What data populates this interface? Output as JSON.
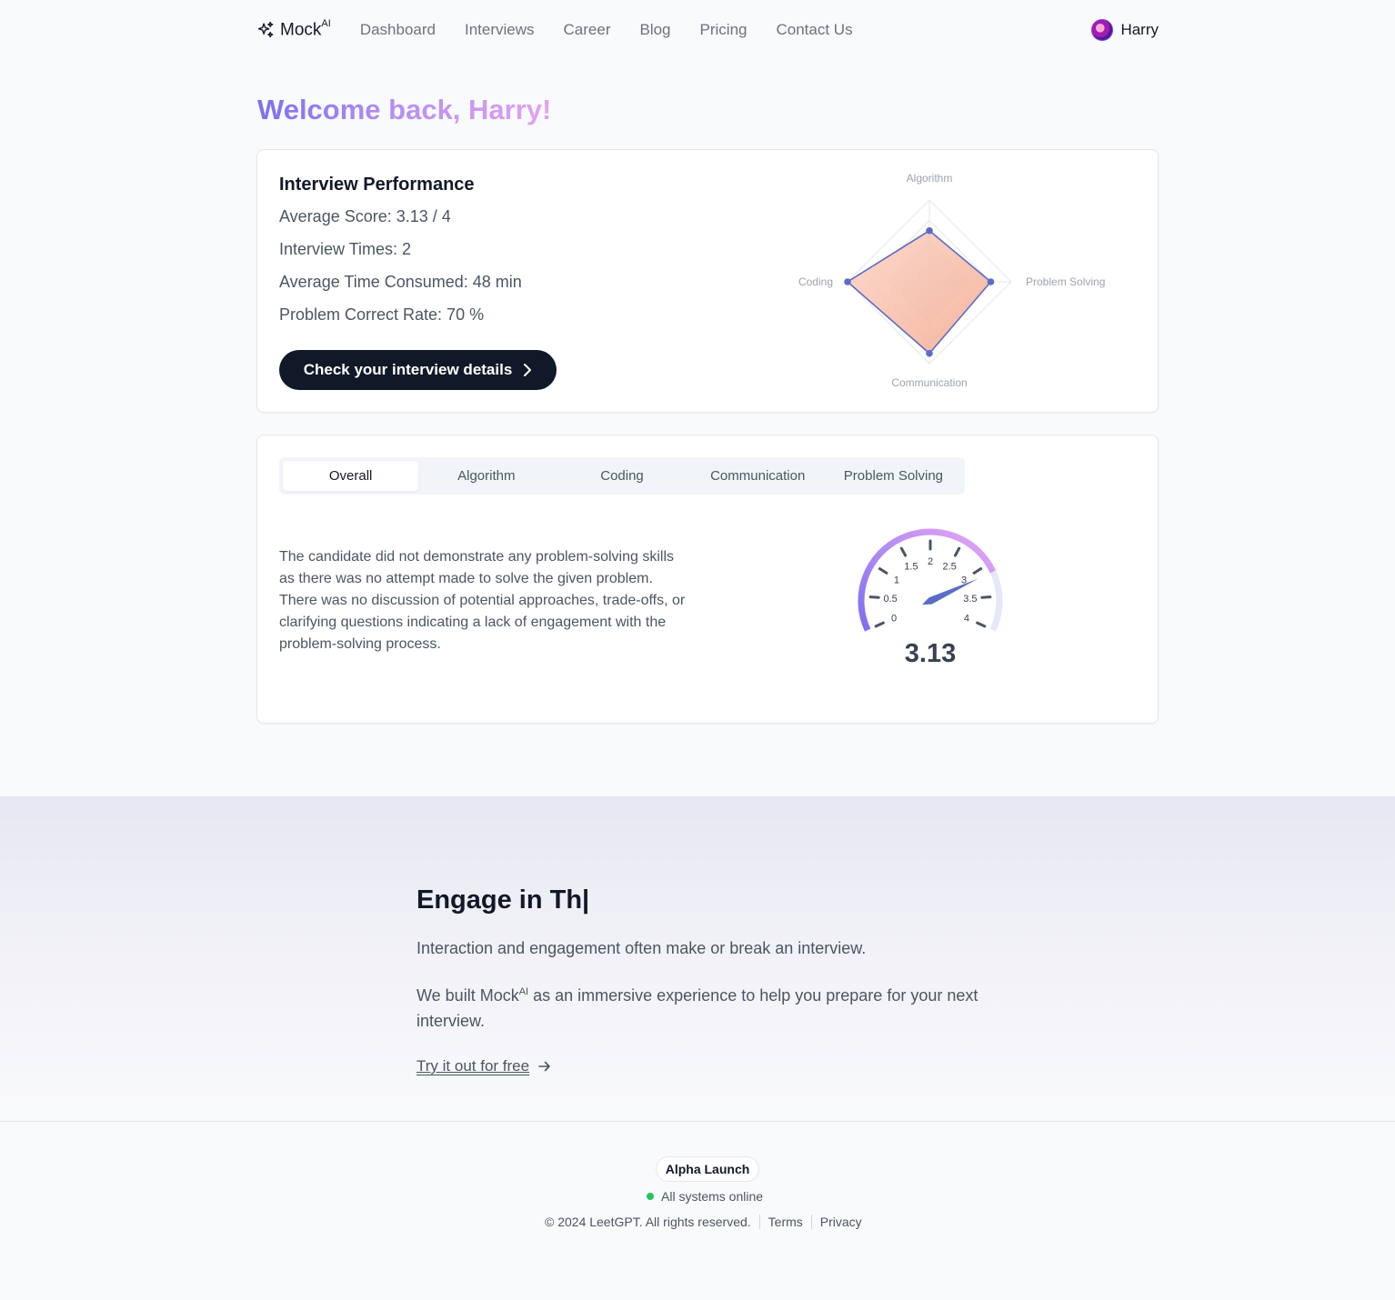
{
  "header": {
    "brand": "Mock",
    "brand_sup": "AI",
    "nav": [
      "Dashboard",
      "Interviews",
      "Career",
      "Blog",
      "Pricing",
      "Contact Us"
    ],
    "user": "Harry"
  },
  "welcome": "Welcome back, Harry!",
  "performance": {
    "title": "Interview Performance",
    "average_score": "Average Score: 3.13 / 4",
    "interview_times": "Interview Times: 2",
    "average_time": "Average Time Consumed: 48 min",
    "correct_rate": "Problem Correct Rate: 70 %",
    "cta_label": "Check your interview details"
  },
  "chart_data": [
    {
      "type": "radar",
      "axes": [
        "Algorithm",
        "Problem Solving",
        "Communication",
        "Coding"
      ],
      "max": 4,
      "values": [
        2.5,
        3.0,
        3.5,
        4.0
      ]
    },
    {
      "type": "gauge",
      "min": 0,
      "max": 4,
      "ticks": [
        "0",
        "0.5",
        "1",
        "1.5",
        "2",
        "2.5",
        "3",
        "3.5",
        "4"
      ],
      "value": 3.13,
      "value_label": "3.13"
    }
  ],
  "tabs": {
    "items": [
      "Overall",
      "Algorithm",
      "Coding",
      "Communication",
      "Problem Solving"
    ],
    "active": "Overall"
  },
  "feedback": "The candidate did not demonstrate any problem-solving skills as there was no attempt made to solve the given problem. There was no discussion of potential approaches, trade-offs, or clarifying questions indicating a lack of engagement with the problem-solving process.",
  "engage": {
    "title": "Engage in  Th|",
    "p1": "Interaction and engagement often make or break an interview.",
    "p2_pre": "We built Mock",
    "p2_sup": "AI",
    "p2_post": " as an immersive experience to help you prepare for your next interview.",
    "link": "Try it out for free"
  },
  "footer": {
    "badge": "Alpha Launch",
    "status": "All systems online",
    "copyright": "© 2024 LeetGPT. All rights reserved.",
    "terms": "Terms",
    "privacy": "Privacy"
  },
  "colors": {
    "accent_purple": "#7c6ff0",
    "radar_line": "#5b6cc7",
    "radar_fill": "#f4a98e",
    "status_green": "#22c55e",
    "button_dark": "#111827"
  }
}
